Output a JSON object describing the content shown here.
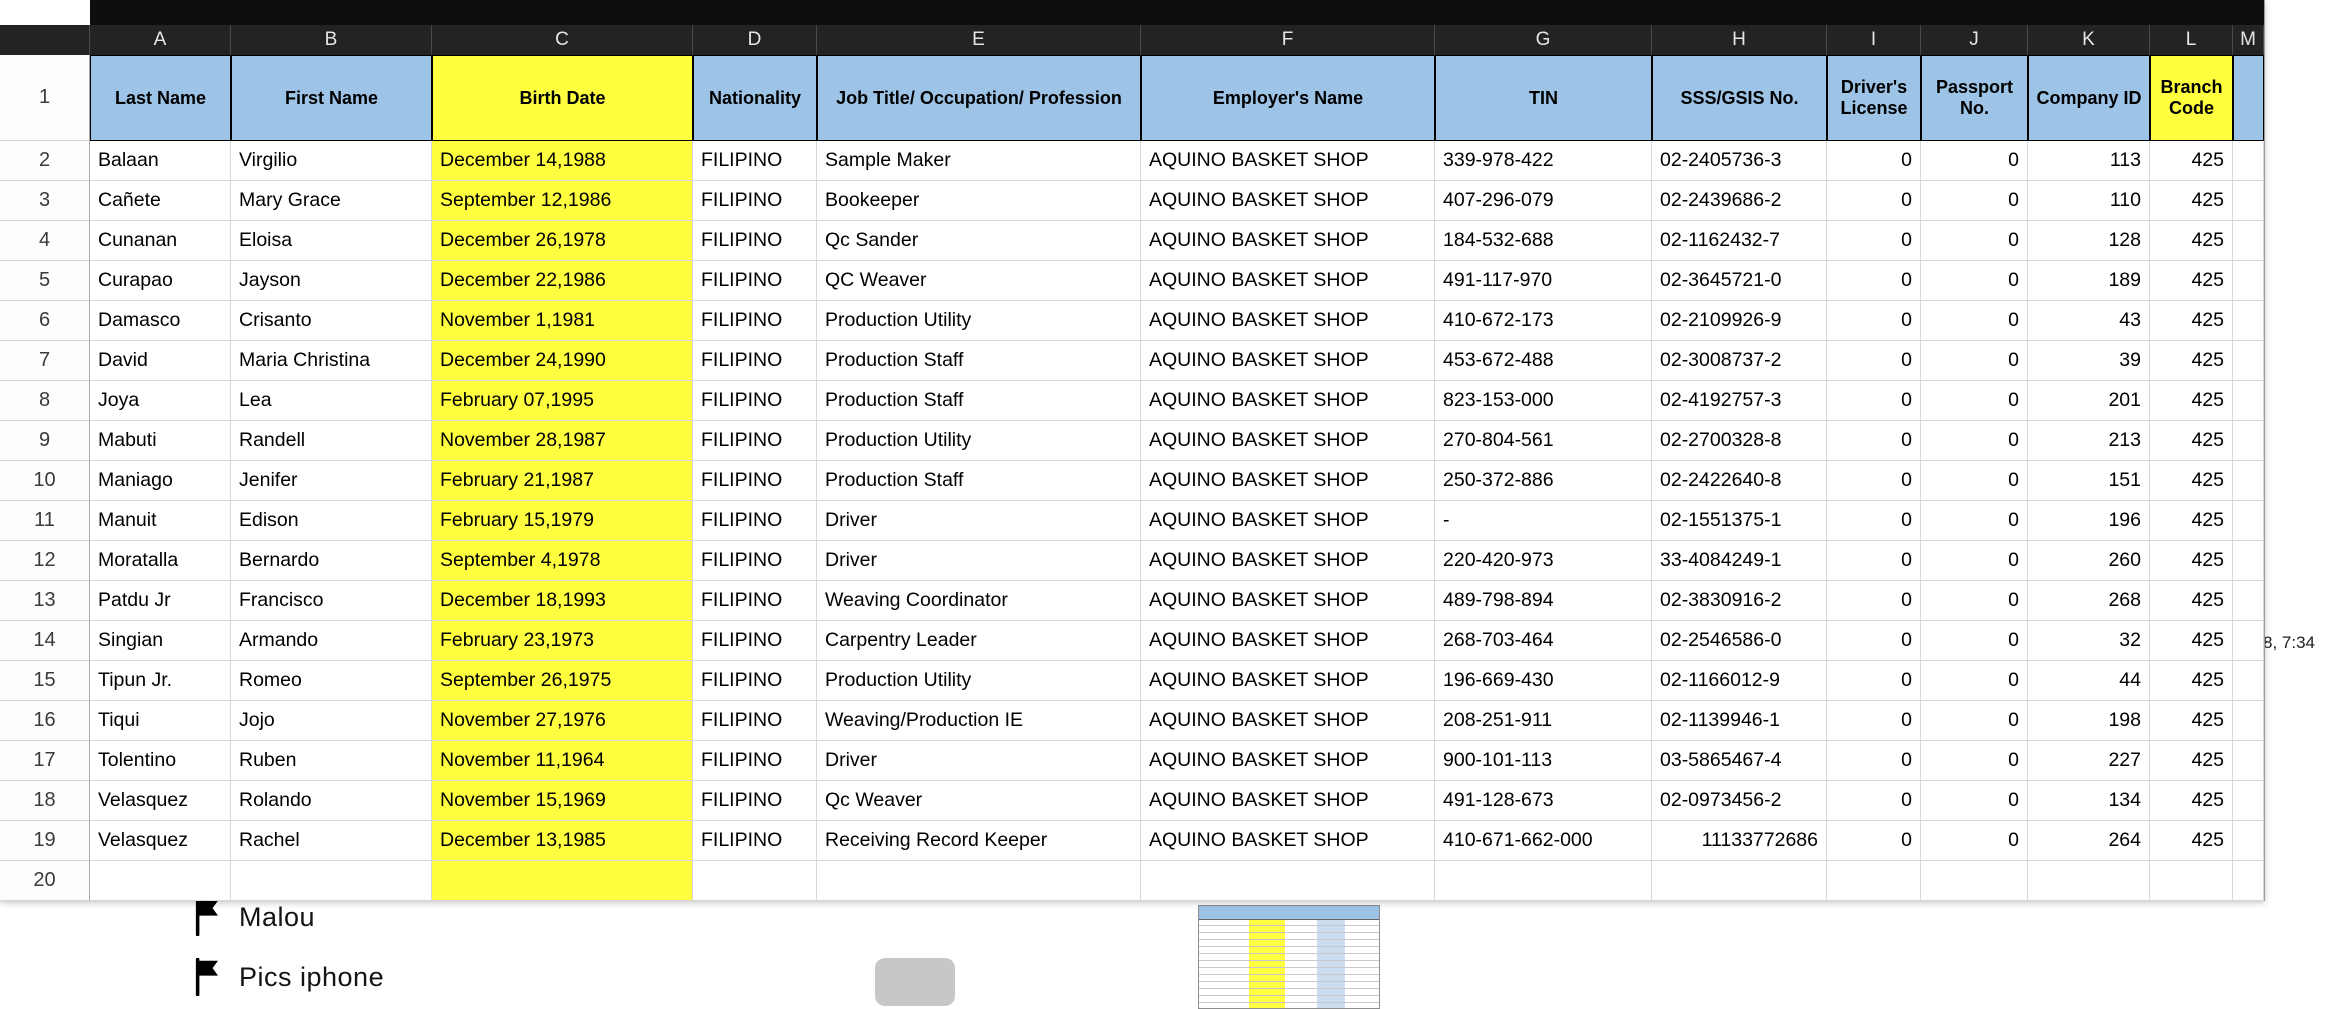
{
  "colors": {
    "header_blue": "#9DC3E6",
    "highlight_yellow": "#FFFF40",
    "strip_bg": "#232323",
    "strip_text": "#E6E6E6",
    "top_bar": "#0E0E0E",
    "gridline": "#D8D8D8"
  },
  "spreadsheet": {
    "column_letters": [
      "A",
      "B",
      "C",
      "D",
      "E",
      "F",
      "G",
      "H",
      "I",
      "J",
      "K",
      "L",
      "M"
    ],
    "row_numbers": [
      "1",
      "2",
      "3",
      "4",
      "5",
      "6",
      "7",
      "8",
      "9",
      "10",
      "11",
      "12",
      "13",
      "14",
      "15",
      "16",
      "17",
      "18",
      "19",
      "20"
    ],
    "headers": [
      "Last Name",
      "First Name",
      "Birth Date",
      "Nationality",
      "Job Title/ Occupation/ Profession",
      "Employer's Name",
      "TIN",
      "SSS/GSIS No.",
      "Driver's License",
      "Passport No.",
      "Company ID",
      "Branch Code",
      ""
    ],
    "rows": [
      [
        "Balaan",
        "Virgilio",
        "December 14,1988",
        "FILIPINO",
        "Sample Maker",
        "AQUINO BASKET SHOP",
        "339-978-422",
        "02-2405736-3",
        "0",
        "0",
        "113",
        "425",
        ""
      ],
      [
        "Cañete",
        "Mary Grace",
        "September 12,1986",
        "FILIPINO",
        "Bookeeper",
        "AQUINO BASKET SHOP",
        "407-296-079",
        "02-2439686-2",
        "0",
        "0",
        "110",
        "425",
        ""
      ],
      [
        "Cunanan",
        "Eloisa",
        "December 26,1978",
        "FILIPINO",
        "Qc Sander",
        "AQUINO BASKET SHOP",
        "184-532-688",
        "02-1162432-7",
        "0",
        "0",
        "128",
        "425",
        ""
      ],
      [
        "Curapao",
        "Jayson",
        "December 22,1986",
        "FILIPINO",
        "QC Weaver",
        "AQUINO BASKET SHOP",
        "491-117-970",
        "02-3645721-0",
        "0",
        "0",
        "189",
        "425",
        ""
      ],
      [
        "Damasco",
        "Crisanto",
        "November 1,1981",
        "FILIPINO",
        "Production Utility",
        "AQUINO BASKET SHOP",
        "410-672-173",
        "02-2109926-9",
        "0",
        "0",
        "43",
        "425",
        ""
      ],
      [
        "David",
        "Maria Christina",
        "December 24,1990",
        "FILIPINO",
        "Production Staff",
        "AQUINO BASKET SHOP",
        "453-672-488",
        "02-3008737-2",
        "0",
        "0",
        "39",
        "425",
        ""
      ],
      [
        "Joya",
        "Lea",
        "February 07,1995",
        "FILIPINO",
        "Production Staff",
        "AQUINO BASKET SHOP",
        "823-153-000",
        "02-4192757-3",
        "0",
        "0",
        "201",
        "425",
        ""
      ],
      [
        "Mabuti",
        "Randell",
        "November 28,1987",
        "FILIPINO",
        "Production Utility",
        "AQUINO BASKET SHOP",
        "270-804-561",
        "02-2700328-8",
        "0",
        "0",
        "213",
        "425",
        ""
      ],
      [
        "Maniago",
        "Jenifer",
        "February 21,1987",
        "FILIPINO",
        "Production Staff",
        "AQUINO BASKET SHOP",
        "250-372-886",
        "02-2422640-8",
        "0",
        "0",
        "151",
        "425",
        ""
      ],
      [
        "Manuit",
        "Edison",
        "February 15,1979",
        "FILIPINO",
        "Driver",
        "AQUINO BASKET SHOP",
        "-",
        "02-1551375-1",
        "0",
        "0",
        "196",
        "425",
        ""
      ],
      [
        "Moratalla",
        "Bernardo",
        "September 4,1978",
        "FILIPINO",
        "Driver",
        "AQUINO BASKET SHOP",
        "220-420-973",
        "33-4084249-1",
        "0",
        "0",
        "260",
        "425",
        ""
      ],
      [
        "Patdu Jr",
        "Francisco",
        "December 18,1993",
        "FILIPINO",
        "Weaving Coordinator",
        "AQUINO BASKET SHOP",
        "489-798-894",
        "02-3830916-2",
        "0",
        "0",
        "268",
        "425",
        ""
      ],
      [
        "Singian",
        "Armando",
        "February 23,1973",
        "FILIPINO",
        "Carpentry Leader",
        "AQUINO BASKET SHOP",
        "268-703-464",
        "02-2546586-0",
        "0",
        "0",
        "32",
        "425",
        ""
      ],
      [
        "Tipun Jr.",
        "Romeo",
        "September 26,1975",
        "FILIPINO",
        "Production Utility",
        "AQUINO BASKET SHOP",
        "196-669-430",
        "02-1166012-9",
        "0",
        "0",
        "44",
        "425",
        ""
      ],
      [
        "Tiqui",
        "Jojo",
        "November 27,1976",
        "FILIPINO",
        "Weaving/Production IE",
        "AQUINO BASKET SHOP",
        "208-251-911",
        "02-1139946-1",
        "0",
        "0",
        "198",
        "425",
        ""
      ],
      [
        "Tolentino",
        "Ruben",
        "November 11,1964",
        "FILIPINO",
        "Driver",
        "AQUINO BASKET SHOP",
        "900-101-113",
        "03-5865467-4",
        "0",
        "0",
        "227",
        "425",
        ""
      ],
      [
        "Velasquez",
        "Rolando",
        "November 15,1969",
        "FILIPINO",
        "Qc Weaver",
        "AQUINO BASKET SHOP",
        "491-128-673",
        "02-0973456-2",
        "0",
        "0",
        "134",
        "425",
        ""
      ],
      [
        "Velasquez",
        "Rachel",
        "December 13,1985",
        "FILIPINO",
        "Receiving Record Keeper",
        "AQUINO BASKET SHOP",
        "410-671-662-000",
        "11133772686",
        "0",
        "0",
        "264",
        "425",
        ""
      ],
      [
        "",
        "",
        "",
        "",
        "",
        "",
        "",
        "",
        "",
        "",
        "",
        "",
        ""
      ]
    ]
  },
  "desktop": {
    "files": [
      {
        "name": "Malou"
      },
      {
        "name": "Pics iphone"
      }
    ],
    "partial_text": "8, 7:34"
  }
}
